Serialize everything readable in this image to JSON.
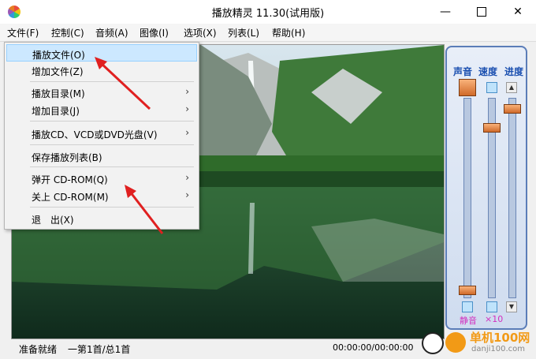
{
  "window": {
    "title": "播放精灵 11.30(试用版)"
  },
  "menubar": {
    "items": [
      {
        "label": "文件(F)"
      },
      {
        "label": "控制(C)"
      },
      {
        "label": "音频(A)"
      },
      {
        "label": "图像(I)"
      },
      {
        "label": "选项(X)"
      },
      {
        "label": "列表(L)"
      },
      {
        "label": "帮助(H)"
      }
    ]
  },
  "file_menu": {
    "items": [
      {
        "label": "播放文件(O)",
        "has_submenu": false,
        "selected": true
      },
      {
        "label": "增加文件(Z)",
        "has_submenu": false
      },
      {
        "label": "播放目录(M)",
        "has_submenu": true
      },
      {
        "label": "增加目录(J)",
        "has_submenu": true
      },
      {
        "label": "播放CD、VCD或DVD光盘(V)",
        "has_submenu": true
      },
      {
        "label": "保存播放列表(B)",
        "has_submenu": false
      },
      {
        "label": "弹开 CD-ROM(Q)",
        "has_submenu": true
      },
      {
        "label": "关上 CD-ROM(M)",
        "has_submenu": true
      },
      {
        "label": "退　出(X)",
        "has_submenu": false
      }
    ]
  },
  "side_panel": {
    "volume_label": "声音",
    "speed_label": "速度",
    "progress_label": "进度",
    "mute_label": "静音",
    "speed_multiplier": "×10"
  },
  "status": {
    "state": "准备就绪",
    "track_info": "一第1首/总1首",
    "time": "00:00:00/00:00:00"
  },
  "watermark": {
    "text": "单机100网",
    "sub": "danji100.com"
  },
  "colors": {
    "accent": "#1a4fb0",
    "annotation_arrow": "#e02020",
    "menu_highlight": "#cce8ff"
  }
}
